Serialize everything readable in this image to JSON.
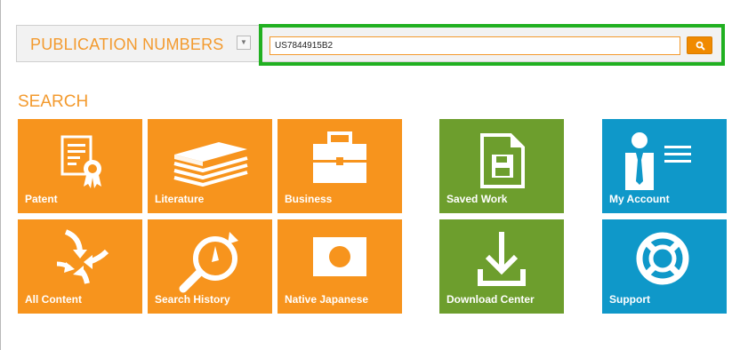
{
  "search": {
    "type_label": "PUBLICATION NUMBERS",
    "dropdown_glyph": "▼",
    "query": "US7844915B2"
  },
  "section": {
    "title": "SEARCH"
  },
  "tiles": [
    {
      "label": "Patent",
      "icon": "patent-certificate-icon",
      "color": "#f7941d"
    },
    {
      "label": "Literature",
      "icon": "book-stack-icon",
      "color": "#f7941d"
    },
    {
      "label": "Business",
      "icon": "briefcase-icon",
      "color": "#f7941d"
    },
    {
      "label": "Saved Work",
      "icon": "saved-document-icon",
      "color": "#6d9e2d"
    },
    {
      "label": "My Account",
      "icon": "user-account-icon",
      "color": "#0f98c9"
    },
    {
      "label": "All Content",
      "icon": "converging-arrows-icon",
      "color": "#f7941d"
    },
    {
      "label": "Search History",
      "icon": "search-history-icon",
      "color": "#f7941d"
    },
    {
      "label": "Native Japanese",
      "icon": "japan-flag-icon",
      "color": "#f7941d"
    },
    {
      "label": "Download Center",
      "icon": "download-icon",
      "color": "#6d9e2d"
    },
    {
      "label": "Support",
      "icon": "lifebuoy-icon",
      "color": "#0f98c9"
    }
  ],
  "colors": {
    "accent_orange": "#f39a2e",
    "highlight_green": "#21b021",
    "tile_orange": "#f7941d",
    "tile_green": "#6d9e2d",
    "tile_blue": "#0f98c9"
  }
}
